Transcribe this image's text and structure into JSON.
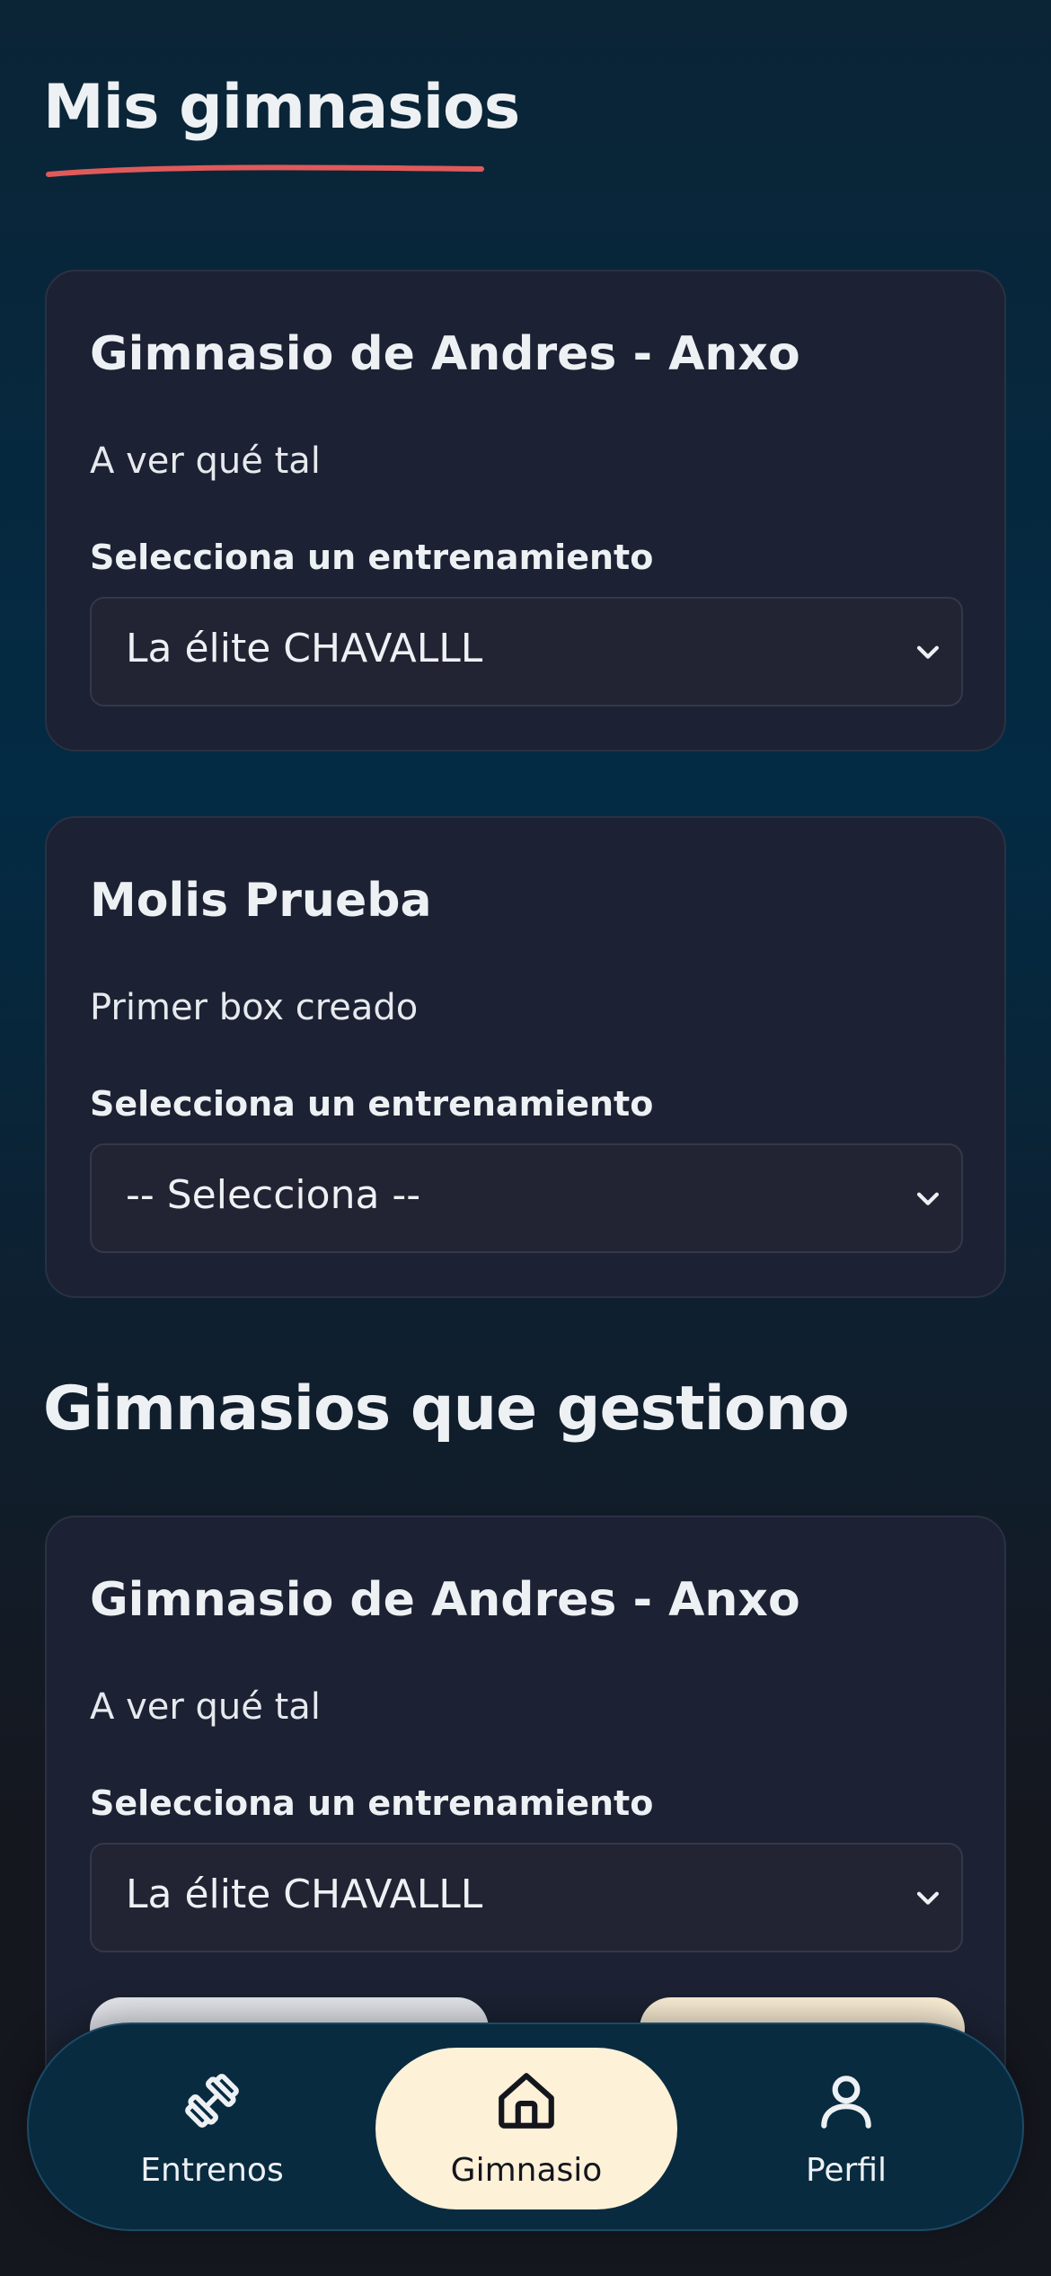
{
  "page": {
    "title": "Mis gimnasios",
    "section2_title": "Gimnasios que gestiono"
  },
  "my_gyms": [
    {
      "name": "Gimnasio de Andres - Anxo",
      "description": "A ver qué tal",
      "select_label": "Selecciona un entrenamiento",
      "selected": "La élite CHAVALLL"
    },
    {
      "name": "Molis Prueba",
      "description": "Primer box creado",
      "select_label": "Selecciona un entrenamiento",
      "selected": "-- Selecciona --"
    }
  ],
  "managed_gyms": [
    {
      "name": "Gimnasio de Andres - Anxo",
      "description": "A ver qué tal",
      "select_label": "Selecciona un entrenamiento",
      "selected": "La élite CHAVALLL"
    }
  ],
  "bottom_nav": {
    "items": [
      {
        "label": "Entrenos",
        "icon": "dumbbell-icon"
      },
      {
        "label": "Gimnasio",
        "icon": "home-icon",
        "active": true
      },
      {
        "label": "Perfil",
        "icon": "user-icon"
      }
    ]
  },
  "colors": {
    "accent_underline": "#e05a5a",
    "nav_active_bg": "#fdf1d8",
    "card_bg": "#1c2233"
  }
}
